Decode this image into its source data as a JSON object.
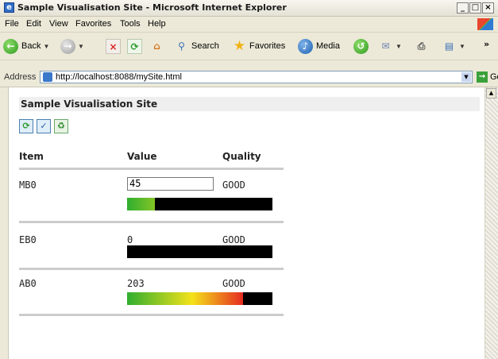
{
  "window": {
    "title": "Sample Visualisation Site - Microsoft Internet Explorer",
    "min_label": "_",
    "max_label": "□",
    "close_label": "×"
  },
  "menu": [
    "File",
    "Edit",
    "View",
    "Favorites",
    "Tools",
    "Help"
  ],
  "toolbar": {
    "back_label": "Back",
    "search_label": "Search",
    "favorites_label": "Favorites",
    "media_label": "Media"
  },
  "address": {
    "label": "Address",
    "url": "http://localhost:8088/mySite.html",
    "go_label": "Go"
  },
  "page": {
    "site_title": "Sample Visualisation Site",
    "headers": {
      "item": "Item",
      "value": "Value",
      "quality": "Quality"
    },
    "rows": [
      {
        "item": "MB0",
        "value": "45",
        "quality": "GOOD",
        "level": 0.19
      },
      {
        "item": "EB0",
        "value": "0",
        "quality": "GOOD",
        "level": 0.0
      },
      {
        "item": "AB0",
        "value": "203",
        "quality": "GOOD",
        "level": 0.8
      }
    ]
  },
  "colors": {
    "bar_start": "#2fae2f",
    "bar_mid": "#f4e21a",
    "bar_end": "#e52b20",
    "bar_bg": "#000000"
  }
}
